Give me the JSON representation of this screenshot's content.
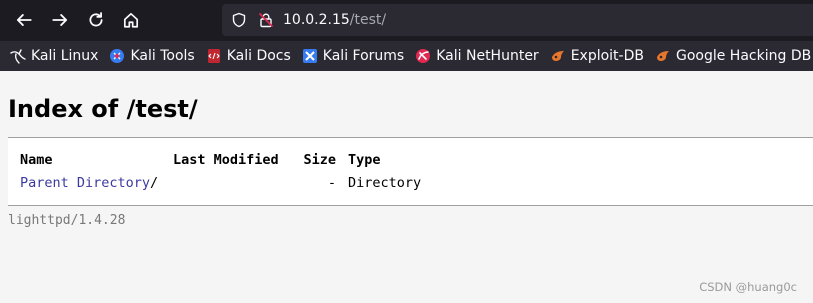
{
  "toolbar": {
    "back_icon": "arrow-left-icon",
    "forward_icon": "arrow-right-icon",
    "reload_icon": "reload-icon",
    "home_icon": "home-icon"
  },
  "url_bar": {
    "host": "10.0.2.15",
    "path": "/test/",
    "lock_color": "#e22850"
  },
  "bookmarks": [
    {
      "label": "Kali Linux",
      "icon": "kali-dragon-icon"
    },
    {
      "label": "Kali Tools",
      "icon": "kali-tools-icon"
    },
    {
      "label": "Kali Docs",
      "icon": "kali-docs-icon"
    },
    {
      "label": "Kali Forums",
      "icon": "kali-forums-icon"
    },
    {
      "label": "Kali NetHunter",
      "icon": "nethunter-icon"
    },
    {
      "label": "Exploit-DB",
      "icon": "exploit-db-icon"
    },
    {
      "label": "Google Hacking DB",
      "icon": "ghdb-icon"
    }
  ],
  "page": {
    "title": "Index of /test/",
    "columns": {
      "name": "Name",
      "modified": "Last Modified",
      "size": "Size",
      "type": "Type"
    },
    "rows": [
      {
        "name": "Parent Directory",
        "suffix": "/",
        "modified": "",
        "size": "-",
        "type": "Directory"
      }
    ],
    "footer": "lighttpd/1.4.28"
  },
  "watermark": "CSDN @huang0c"
}
